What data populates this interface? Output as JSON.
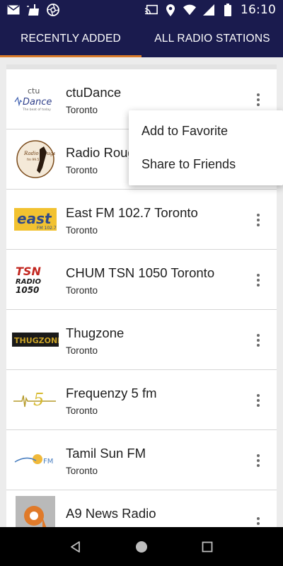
{
  "status_bar": {
    "time": "16:10",
    "icons_left": [
      "mail-icon",
      "cleaner-icon",
      "camera-aperture-icon"
    ],
    "icons_right": [
      "cast-icon",
      "location-icon",
      "wifi-icon",
      "signal-icon",
      "battery-icon"
    ]
  },
  "tabs": [
    {
      "label": "RECENTLY ADDED",
      "active": true
    },
    {
      "label": "ALL RADIO STATIONS",
      "active": false
    }
  ],
  "stations": [
    {
      "name": "ctuDance",
      "city": "Toronto",
      "logo": "ctudance-logo",
      "logo_lines": [
        "ctu",
        "Dance",
        "The beat of today"
      ]
    },
    {
      "name": "Radio Rouge",
      "city": "Toronto",
      "logo": "radio-rouge-logo",
      "logo_lines": [
        "Radio Rouge",
        "fm 99.5"
      ]
    },
    {
      "name": "East FM 102.7 Toronto",
      "city": "Toronto",
      "logo": "east-fm-logo",
      "logo_lines": [
        "east",
        "FM 102.7"
      ]
    },
    {
      "name": "CHUM TSN 1050 Toronto",
      "city": "Toronto",
      "logo": "tsn-radio-logo",
      "logo_lines": [
        "TSN",
        "RADIO",
        "1050"
      ]
    },
    {
      "name": "Thugzone",
      "city": "Toronto",
      "logo": "thugzone-logo",
      "logo_lines": [
        "THUGZONE"
      ]
    },
    {
      "name": "Frequenzy 5 fm",
      "city": "Toronto",
      "logo": "frequenzy-logo",
      "logo_lines": [
        "5"
      ]
    },
    {
      "name": "Tamil Sun FM",
      "city": "Toronto",
      "logo": "tamil-sun-logo",
      "logo_lines": [
        "FM"
      ]
    },
    {
      "name": "A9 News Radio",
      "city": "",
      "logo": "a9-news-logo",
      "logo_lines": []
    }
  ],
  "popup_menu": {
    "items": [
      "Add to Favorite",
      "Share to Friends"
    ]
  },
  "nav_bar": {
    "buttons": [
      "back-icon",
      "home-icon",
      "recents-icon"
    ]
  },
  "colors": {
    "primary": "#1a1b4e",
    "tab_indicator": "#d97a29",
    "background": "#ececec"
  }
}
